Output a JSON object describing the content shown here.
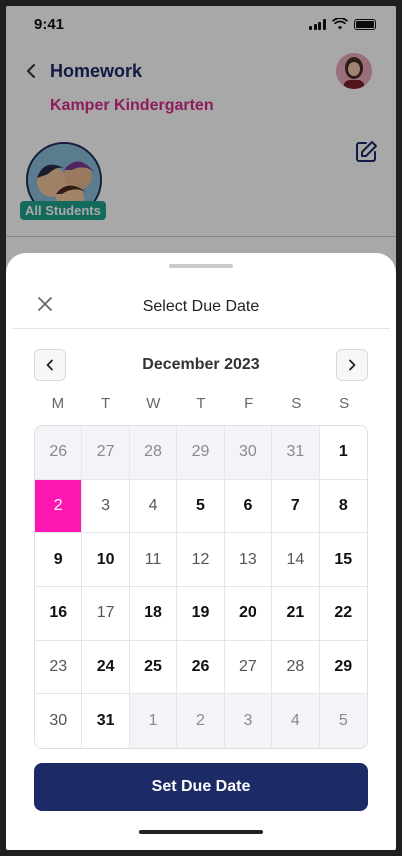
{
  "status_bar": {
    "time": "9:41"
  },
  "header": {
    "title": "Homework",
    "subtitle": "Kamper Kindergarten"
  },
  "group": {
    "label": "All Students"
  },
  "sheet": {
    "title": "Select Due Date",
    "month_label": "December 2023",
    "weekdays": [
      "M",
      "T",
      "W",
      "T",
      "F",
      "S",
      "S"
    ],
    "days": [
      {
        "label": "26",
        "style": "other"
      },
      {
        "label": "27",
        "style": "other"
      },
      {
        "label": "28",
        "style": "other"
      },
      {
        "label": "29",
        "style": "other"
      },
      {
        "label": "30",
        "style": "other"
      },
      {
        "label": "31",
        "style": "other"
      },
      {
        "label": "1",
        "style": "strong"
      },
      {
        "label": "2",
        "style": "selected"
      },
      {
        "label": "3",
        "style": "muted"
      },
      {
        "label": "4",
        "style": "muted"
      },
      {
        "label": "5",
        "style": "strong"
      },
      {
        "label": "6",
        "style": "strong"
      },
      {
        "label": "7",
        "style": "strong"
      },
      {
        "label": "8",
        "style": "strong"
      },
      {
        "label": "9",
        "style": "strong"
      },
      {
        "label": "10",
        "style": "strong"
      },
      {
        "label": "11",
        "style": "muted"
      },
      {
        "label": "12",
        "style": "muted"
      },
      {
        "label": "13",
        "style": "muted"
      },
      {
        "label": "14",
        "style": "muted"
      },
      {
        "label": "15",
        "style": "strong"
      },
      {
        "label": "16",
        "style": "strong"
      },
      {
        "label": "17",
        "style": "muted"
      },
      {
        "label": "18",
        "style": "strong"
      },
      {
        "label": "19",
        "style": "strong"
      },
      {
        "label": "20",
        "style": "strong"
      },
      {
        "label": "21",
        "style": "strong"
      },
      {
        "label": "22",
        "style": "strong"
      },
      {
        "label": "23",
        "style": "muted"
      },
      {
        "label": "24",
        "style": "strong"
      },
      {
        "label": "25",
        "style": "strong"
      },
      {
        "label": "26",
        "style": "strong"
      },
      {
        "label": "27",
        "style": "muted"
      },
      {
        "label": "28",
        "style": "muted"
      },
      {
        "label": "29",
        "style": "strong"
      },
      {
        "label": "30",
        "style": "muted"
      },
      {
        "label": "31",
        "style": "strong"
      },
      {
        "label": "1",
        "style": "other"
      },
      {
        "label": "2",
        "style": "other"
      },
      {
        "label": "3",
        "style": "other"
      },
      {
        "label": "4",
        "style": "other"
      },
      {
        "label": "5",
        "style": "other"
      }
    ],
    "set_button_label": "Set Due Date"
  },
  "colors": {
    "primary": "#1c2a66",
    "accent": "#ff17b4",
    "subtitle": "#d62b8f",
    "badge": "#1fa38c"
  },
  "icons": {
    "back": "chevron-left-icon",
    "edit": "edit-icon",
    "close": "close-icon",
    "prev": "chevron-left-icon",
    "next": "chevron-right-icon"
  }
}
